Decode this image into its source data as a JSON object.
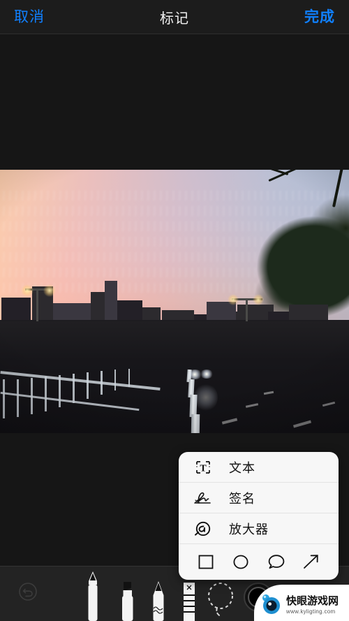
{
  "navbar": {
    "cancel_label": "取消",
    "title": "标记",
    "done_label": "完成"
  },
  "colors": {
    "accent_blue": "#1080ff",
    "nav_background": "#1c1c1c",
    "canvas_background": "#161616",
    "toolbar_background": "#232323",
    "popup_background": "#f7f7f7",
    "popup_text": "#111111",
    "watermark_blue": "#1e9ae0"
  },
  "photo": {
    "alt_description": "城市街道黄昏照片"
  },
  "popup_menu": {
    "items": [
      {
        "icon": "text-box-icon",
        "label": "文本"
      },
      {
        "icon": "signature-icon",
        "label": "签名"
      },
      {
        "icon": "magnifier-icon",
        "label": "放大器"
      }
    ],
    "shapes": [
      {
        "icon": "square-shape-icon"
      },
      {
        "icon": "circle-shape-icon"
      },
      {
        "icon": "speech-bubble-shape-icon"
      },
      {
        "icon": "arrow-shape-icon"
      }
    ]
  },
  "toolbar": {
    "undo_icon": "undo-icon",
    "tools": [
      {
        "name": "pen-tool",
        "icon": "pen-icon",
        "selected": true
      },
      {
        "name": "marker-tool",
        "icon": "marker-icon",
        "selected": false
      },
      {
        "name": "pencil-tool",
        "icon": "pencil-icon",
        "selected": false
      },
      {
        "name": "eraser-tool",
        "icon": "eraser-icon",
        "selected": false
      },
      {
        "name": "lasso-tool",
        "icon": "lasso-icon",
        "selected": false
      }
    ],
    "color_well": {
      "icon": "color-well-icon",
      "color": "#000000"
    }
  },
  "watermark": {
    "title": "快眼游戏网",
    "url": "www.kyligting.com",
    "logo_icon": "eye-logo-icon"
  }
}
